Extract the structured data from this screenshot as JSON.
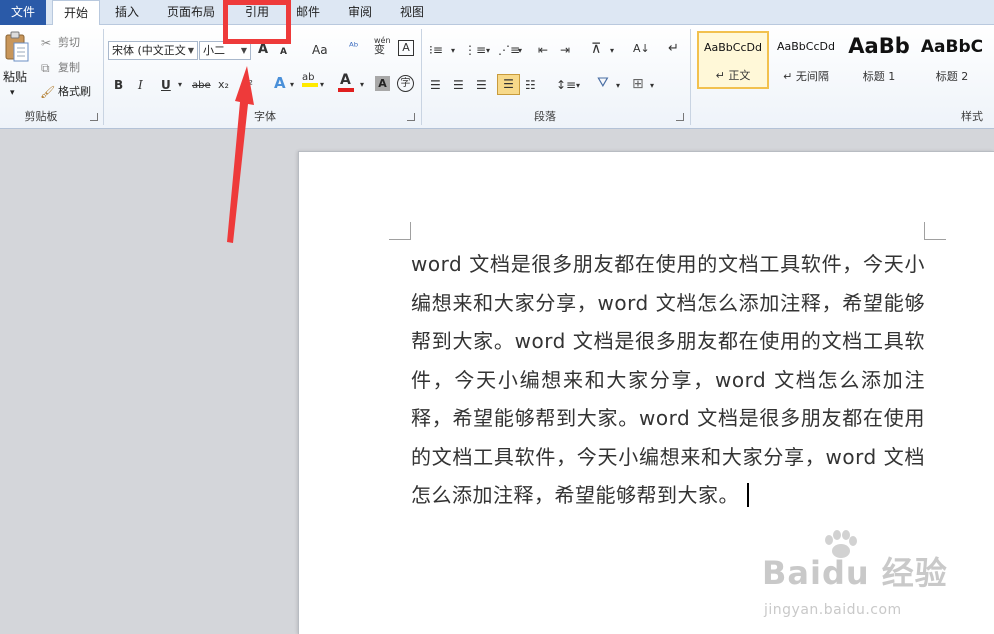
{
  "tabs": [
    {
      "label": "文件"
    },
    {
      "label": "开始"
    },
    {
      "label": "插入"
    },
    {
      "label": "页面布局"
    },
    {
      "label": "引用"
    },
    {
      "label": "邮件"
    },
    {
      "label": "审阅"
    },
    {
      "label": "视图"
    }
  ],
  "clipboard": {
    "paste": "粘贴",
    "cut": "剪切",
    "copy": "复制",
    "format_painter": "格式刷",
    "label": "剪贴板"
  },
  "font": {
    "family": "宋体 (中文正文",
    "size": "小二",
    "grow": "A",
    "shrink": "A",
    "case": "Aa",
    "bold": "B",
    "italic": "I",
    "underline": "U",
    "strike": "abe",
    "subscript": "x₂",
    "superscript": "x²",
    "label": "字体",
    "pinyin_top": "wén",
    "pinyin_bottom": "变",
    "border_char": "A",
    "shade_char": "A",
    "enclose_char": "字"
  },
  "paragraph": {
    "label": "段落"
  },
  "styles": {
    "label": "样式",
    "items": [
      {
        "sample": "AaBbCcDd",
        "name": "↵ 正文"
      },
      {
        "sample": "AaBbCcDd",
        "name": "↵ 无间隔"
      },
      {
        "sample": "AaBb",
        "name": "标题 1"
      },
      {
        "sample": "AaBbC",
        "name": "标题 2"
      }
    ]
  },
  "document": {
    "text": "word 文档是很多朋友都在使用的文档工具软件，今天小编想来和大家分享，word 文档怎么添加注释，希望能够帮到大家。word 文档是很多朋友都在使用的文档工具软件，今天小编想来和大家分享，word 文档怎么添加注释，希望能够帮到大家。word 文档是很多朋友都在使用的文档工具软件，今天小编想来和大家分享，word 文档怎么添加注释，希望能够帮到大家。"
  },
  "watermark": {
    "main": "Baidu 经验",
    "sub": "jingyan.baidu.com"
  },
  "colors": {
    "highlight_box": "#ee3a3a",
    "file_tab": "#2a5aa8",
    "style_selected": "#f2c14e"
  }
}
